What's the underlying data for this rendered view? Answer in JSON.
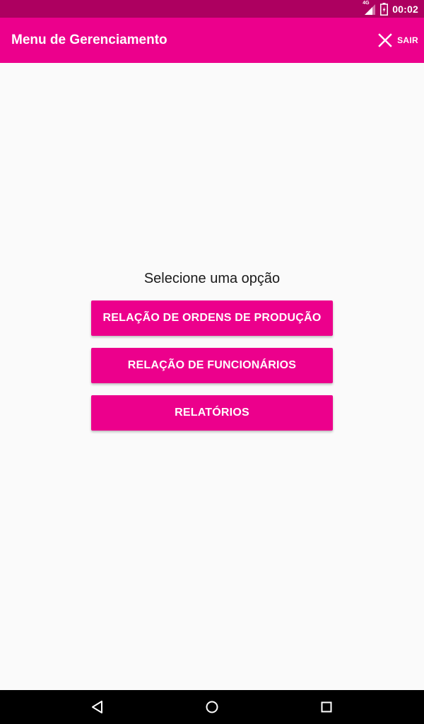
{
  "status_bar": {
    "network_type": "4G",
    "time": "00:02",
    "icons": [
      "signal-icon",
      "battery-icon"
    ]
  },
  "app_bar": {
    "title": "Menu de Gerenciamento",
    "action_icon": "close-icon",
    "action_label": "SAIR"
  },
  "content": {
    "prompt": "Selecione uma opção",
    "buttons": [
      {
        "label": "RELAÇÃO DE ORDENS DE PRODUÇÃO"
      },
      {
        "label": "RELAÇÃO DE FUNCIONÁRIOS"
      },
      {
        "label": "RELATÓRIOS"
      }
    ]
  },
  "nav_bar": {
    "icons": [
      "back-icon",
      "home-icon",
      "recents-icon"
    ]
  },
  "colors": {
    "primary": "#ec008c",
    "primary_dark": "#ad0060",
    "background": "#fafafa",
    "on_primary": "#ffffff"
  }
}
